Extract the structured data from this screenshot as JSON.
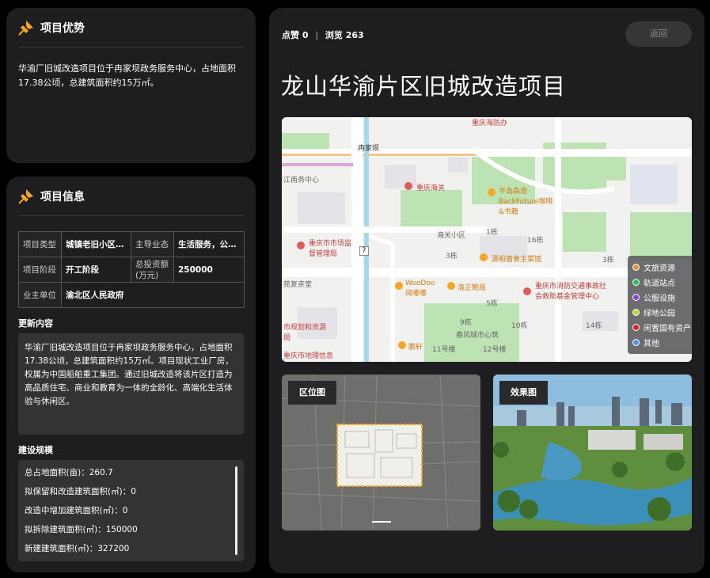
{
  "advantage": {
    "title": "项目优势",
    "text": "华渝厂旧城改造项目位于冉家坝政务服务中心，占地面积17.38公顷，总建筑面积约15万㎡。"
  },
  "info": {
    "title": "项目信息",
    "rows": [
      {
        "k1": "项目类型",
        "v1": "城镇老旧小区…",
        "k2": "主导业态",
        "v2": "生活服务，公…"
      },
      {
        "k1": "项目阶段",
        "v1": "开工阶段",
        "k2": "总投资额(万元)",
        "v2": "250000"
      },
      {
        "k1": "业主单位",
        "v1": "渝北区人民政府"
      }
    ],
    "update_title": "更新内容",
    "update_text": "华渝厂旧城改造项目位于冉家坝政务服务中心，占地面积17.38公顷，总建筑面积约15万㎡。项目现状工业厂房，权属为中国船舶重工集团。通过旧城改造将该片区打造为高品质住宅、商业和教育为一体的全龄化、高端化生活体验与休闲区。",
    "scale_title": "建设规模",
    "scale_items": [
      "总占地面积(亩)：260.7",
      "拟保留和改造建筑面积(㎡)：0",
      "改造中增加建筑面积(㎡)：0",
      "拟拆除建筑面积(㎡)：150000",
      "新建建筑面积(㎡)：327200"
    ]
  },
  "main": {
    "likes_label": "点赞",
    "likes": "0",
    "views_label": "浏览",
    "views": "263",
    "back_label": "返回",
    "title": "龙山华渝片区旧城改造项目",
    "map_labels": [
      "冉家坝",
      "重庆海关",
      "半岛森造 BackFuture咖啡&书籍",
      "海关小区",
      "江南务中心",
      "重庆市市场监督管理局",
      "源船面食主菜馆",
      "重庆市消防交通事故社会救助基金管理中心",
      "WooDoo 阔嘟嘟",
      "渝正鲍局",
      "苑复亲室",
      "市规划和资源局",
      "重庆市地理信息",
      "鹏轩",
      "春风城市心筑",
      "重庆海防办",
      "9栋",
      "10栋",
      "11号楼",
      "12号楼",
      "14栋",
      "16栋",
      "3栋",
      "5栋",
      "1栋",
      "3栋",
      "7"
    ],
    "legend": [
      {
        "label": "文旅资源",
        "color": "#e8963c"
      },
      {
        "label": "轨道站点",
        "color": "#2ec05a"
      },
      {
        "label": "公服设施",
        "color": "#8a46d6"
      },
      {
        "label": "绿地公园",
        "color": "#b6dc3c"
      },
      {
        "label": "闲置国有资产",
        "color": "#e01f1f"
      },
      {
        "label": "其他",
        "color": "#4a9ae0"
      }
    ],
    "thumb_location": "区位图",
    "thumb_effect": "效果图"
  },
  "colors": {
    "panel_bg": "#1e1e20",
    "accent_orange": "#f5a623",
    "map_green": "#bde3b4",
    "map_road": "#ffffff"
  },
  "icons": {
    "header_icon": "pin-icon"
  }
}
